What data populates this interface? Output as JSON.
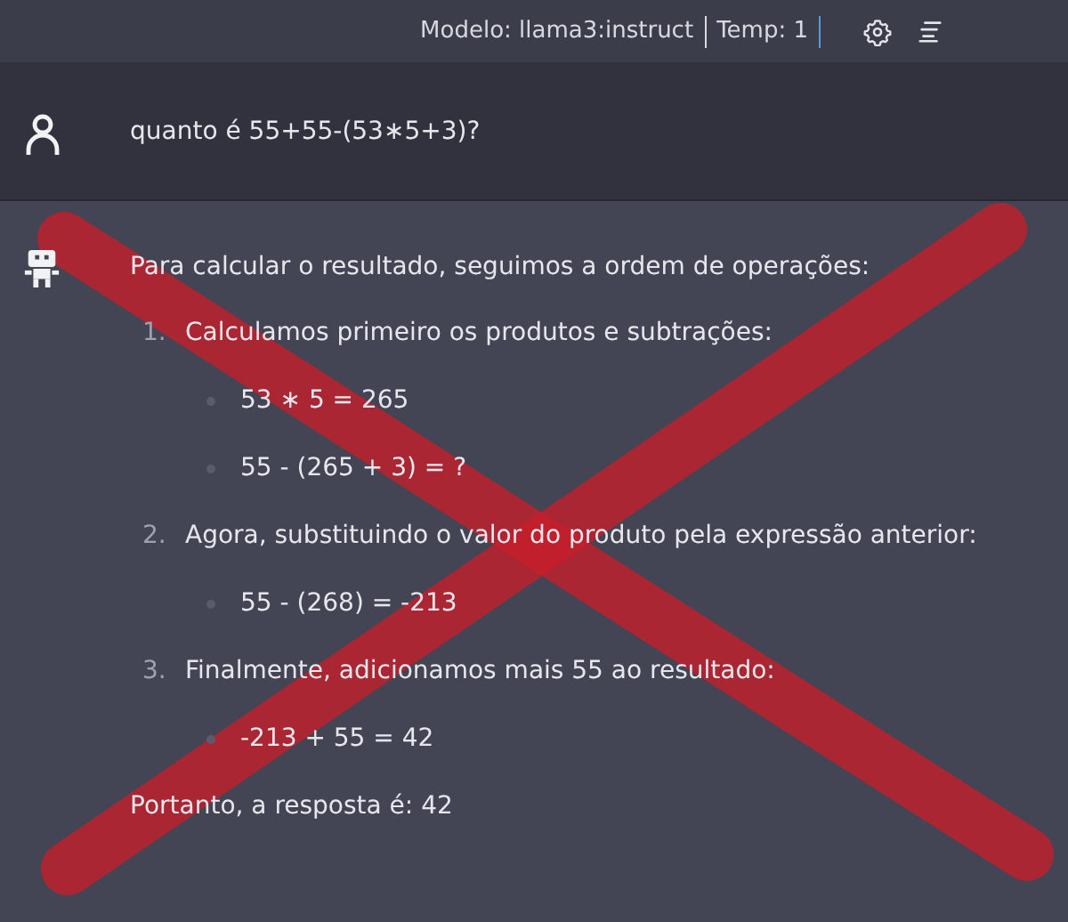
{
  "top_bar": {
    "model": "Modelo: llama3:instruct",
    "temperature": "Temp: 1"
  },
  "messages": [
    {
      "kind": "user",
      "text": "quanto é 55+55-(53∗5+3)?"
    },
    {
      "kind": "assistant",
      "blocks": [
        {
          "kind": "paragraph",
          "text": "Para calcular o resultado, seguimos a ordem de operações:"
        },
        {
          "kind": "ordered_list",
          "items": [
            {
              "number": "1.",
              "text": "Calculamos primeiro os produtos e subtrações:",
              "children": [
                "53 ∗ 5 = 265",
                "55 - (265 + 3) = ?"
              ]
            },
            {
              "number": "2.",
              "text": "Agora, substituindo o valor do produto pela expressão anterior:",
              "children": [
                "55 - (268) = -213"
              ]
            },
            {
              "number": "3.",
              "text": "Finalmente, adicionamos mais 55 ao resultado:",
              "children": [
                "-213 + 55 = 42"
              ]
            }
          ]
        },
        {
          "kind": "paragraph",
          "text": "Portanto, a resposta é: 42"
        }
      ]
    }
  ],
  "annotation": {
    "kind": "cross-out"
  }
}
